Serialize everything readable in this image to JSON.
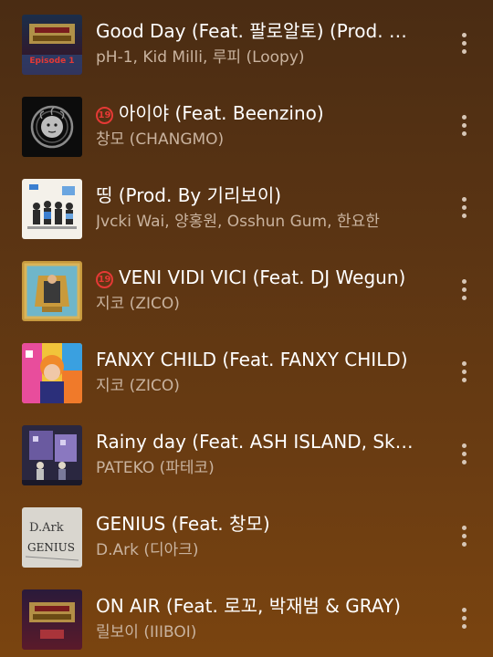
{
  "tracks": [
    {
      "title": "Good Day (Feat. 팔로알토) (Prod. 코드 쿤스트)",
      "artist": "pH-1, Kid Milli, 루피 (Loopy)",
      "explicit": false,
      "art_icon": "show-me-the-money-episode-1-cover",
      "art_text": "Episode 1"
    },
    {
      "title": "아이야 (Feat. Beenzino)",
      "artist": "창모 (CHANGMO)",
      "explicit": true,
      "art_icon": "medusa-head-cover"
    },
    {
      "title": "띵 (Prod. By 기리보이)",
      "artist": "Jvcki Wai, 양홍원, Osshun Gum, 한요한",
      "explicit": false,
      "art_icon": "group-illustration-cover"
    },
    {
      "title": "VENI VIDI VICI (Feat. DJ Wegun)",
      "artist": "지코 (ZICO)",
      "explicit": true,
      "art_icon": "throne-cover"
    },
    {
      "title": "FANXY CHILD (Feat. FANXY CHILD)",
      "artist": "지코 (ZICO)",
      "explicit": false,
      "art_icon": "orange-hair-portrait-cover"
    },
    {
      "title": "Rainy day (Feat. ASH ISLAND, Skinny Brown)",
      "artist": "PATEKO (파테코)",
      "explicit": false,
      "art_icon": "purple-rainy-illustration-cover"
    },
    {
      "title": "GENIUS (Feat. 창모)",
      "artist": "D.Ark (디아크)",
      "explicit": false,
      "art_icon": "handwritten-genius-cover",
      "art_text_1": "D.Ark",
      "art_text_2": "GENIUS"
    },
    {
      "title": "ON AIR (Feat. 로꼬, 박재범 & GRAY)",
      "artist": "릴보이 (IIIBOI)",
      "explicit": false,
      "art_icon": "show-me-the-money-final-cover"
    }
  ],
  "explicit_badge": "19",
  "more_icon": "vertical-ellipsis-icon",
  "colors": {
    "title": "#ffffff",
    "artist": "#c9b39f",
    "explicit": "#e53935"
  }
}
